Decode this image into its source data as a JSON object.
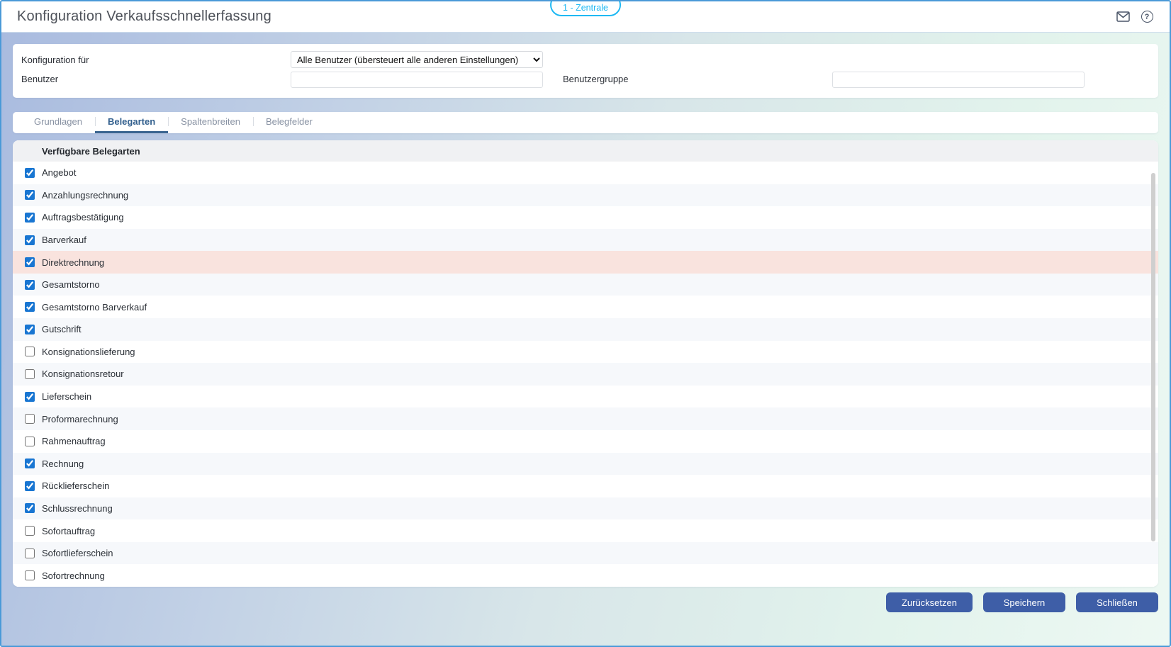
{
  "window": {
    "title": "Konfiguration Verkaufsschnellerfassung",
    "badge": "1 - Zentrale",
    "help_glyph": "?"
  },
  "config": {
    "konfiguration_fuer_label": "Konfiguration für",
    "konfiguration_fuer_value": "Alle Benutzer (übersteuert alle anderen Einstellungen)",
    "benutzer_label": "Benutzer",
    "benutzer_value": "",
    "benutzergruppe_label": "Benutzergruppe",
    "benutzergruppe_value": ""
  },
  "tabs": [
    {
      "id": "grundlagen",
      "label": "Grundlagen",
      "active": false
    },
    {
      "id": "belegarten",
      "label": "Belegarten",
      "active": true
    },
    {
      "id": "spaltenbreiten",
      "label": "Spaltenbreiten",
      "active": false
    },
    {
      "id": "belegfelder",
      "label": "Belegfelder",
      "active": false
    }
  ],
  "list": {
    "header": "Verfügbare Belegarten",
    "items": [
      {
        "label": "Angebot",
        "checked": true,
        "highlighted": false
      },
      {
        "label": "Anzahlungsrechnung",
        "checked": true,
        "highlighted": false
      },
      {
        "label": "Auftragsbestätigung",
        "checked": true,
        "highlighted": false
      },
      {
        "label": "Barverkauf",
        "checked": true,
        "highlighted": false
      },
      {
        "label": "Direktrechnung",
        "checked": true,
        "highlighted": true
      },
      {
        "label": "Gesamtstorno",
        "checked": true,
        "highlighted": false
      },
      {
        "label": "Gesamtstorno Barverkauf",
        "checked": true,
        "highlighted": false
      },
      {
        "label": "Gutschrift",
        "checked": true,
        "highlighted": false
      },
      {
        "label": "Konsignationslieferung",
        "checked": false,
        "highlighted": false
      },
      {
        "label": "Konsignationsretour",
        "checked": false,
        "highlighted": false
      },
      {
        "label": "Lieferschein",
        "checked": true,
        "highlighted": false
      },
      {
        "label": "Proformarechnung",
        "checked": false,
        "highlighted": false
      },
      {
        "label": "Rahmenauftrag",
        "checked": false,
        "highlighted": false
      },
      {
        "label": "Rechnung",
        "checked": true,
        "highlighted": false
      },
      {
        "label": "Rücklieferschein",
        "checked": true,
        "highlighted": false
      },
      {
        "label": "Schlussrechnung",
        "checked": true,
        "highlighted": false
      },
      {
        "label": "Sofortauftrag",
        "checked": false,
        "highlighted": false
      },
      {
        "label": "Sofortlieferschein",
        "checked": false,
        "highlighted": false
      },
      {
        "label": "Sofortrechnung",
        "checked": false,
        "highlighted": false
      }
    ]
  },
  "footer": {
    "buttons": [
      {
        "id": "zuruecksetzen",
        "label": "Zurücksetzen"
      },
      {
        "id": "speichern",
        "label": "Speichern"
      },
      {
        "id": "schliessen",
        "label": "Schließen"
      }
    ]
  },
  "colors": {
    "accent_checkbox": "#1976d2",
    "badge_cyan": "#1fb9f3",
    "button_blue": "#3e5ea7",
    "active_tab": "#33608e",
    "highlight_row": "#f9e3de",
    "alt_row": "#f6f8fb",
    "window_border": "#4a9ad8"
  }
}
